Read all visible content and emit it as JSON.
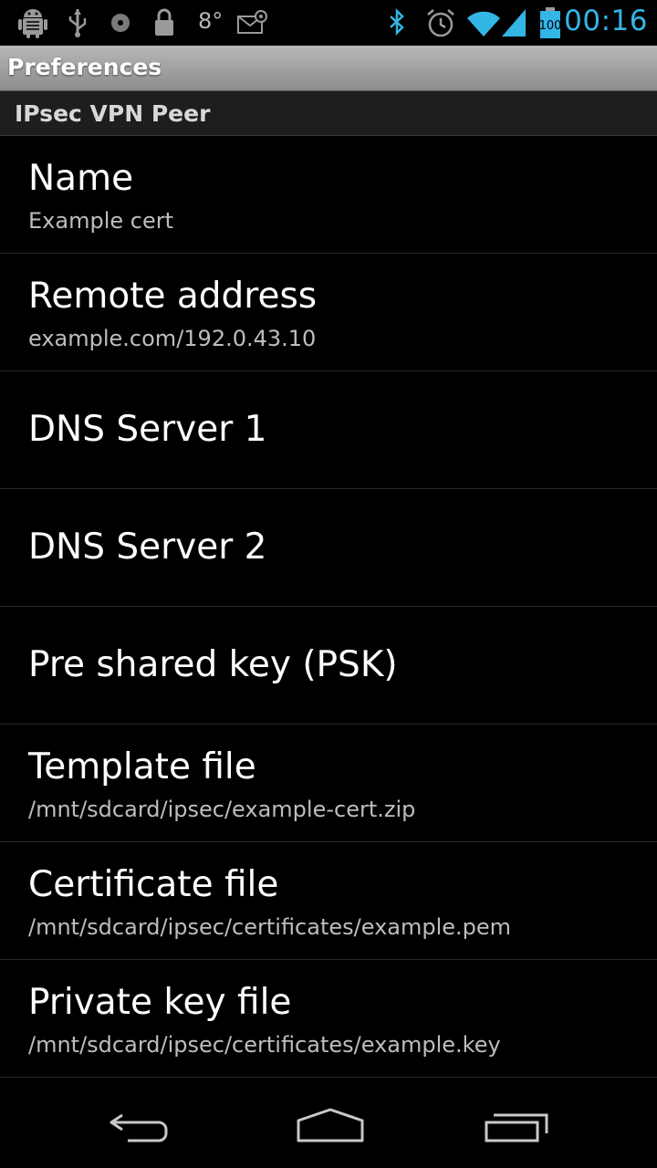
{
  "status_bar": {
    "temperature": "8°",
    "battery_level": "100",
    "clock": "00:16",
    "icons": [
      "android-debug-icon",
      "usb-icon",
      "disc-icon",
      "lock-icon",
      "weather-icon",
      "email-at-icon",
      "bluetooth-icon",
      "alarm-icon",
      "wifi-icon",
      "signal-icon",
      "battery-icon"
    ],
    "clock_color": "#33b5e5"
  },
  "title_bar": {
    "title": "Preferences"
  },
  "category": {
    "title": "IPsec VPN Peer"
  },
  "preferences": [
    {
      "title": "Name",
      "summary": "Example cert"
    },
    {
      "title": "Remote address",
      "summary": "example.com/192.0.43.10"
    },
    {
      "title": "DNS Server 1",
      "summary": ""
    },
    {
      "title": "DNS Server 2",
      "summary": ""
    },
    {
      "title": "Pre shared key (PSK)",
      "summary": ""
    },
    {
      "title": "Template file",
      "summary": "/mnt/sdcard/ipsec/example-cert.zip"
    },
    {
      "title": "Certificate file",
      "summary": "/mnt/sdcard/ipsec/certificates/example.pem"
    },
    {
      "title": "Private key file",
      "summary": "/mnt/sdcard/ipsec/certificates/example.key"
    }
  ],
  "nav_bar": {
    "buttons": [
      "back-icon",
      "home-icon",
      "recent-apps-icon"
    ]
  }
}
